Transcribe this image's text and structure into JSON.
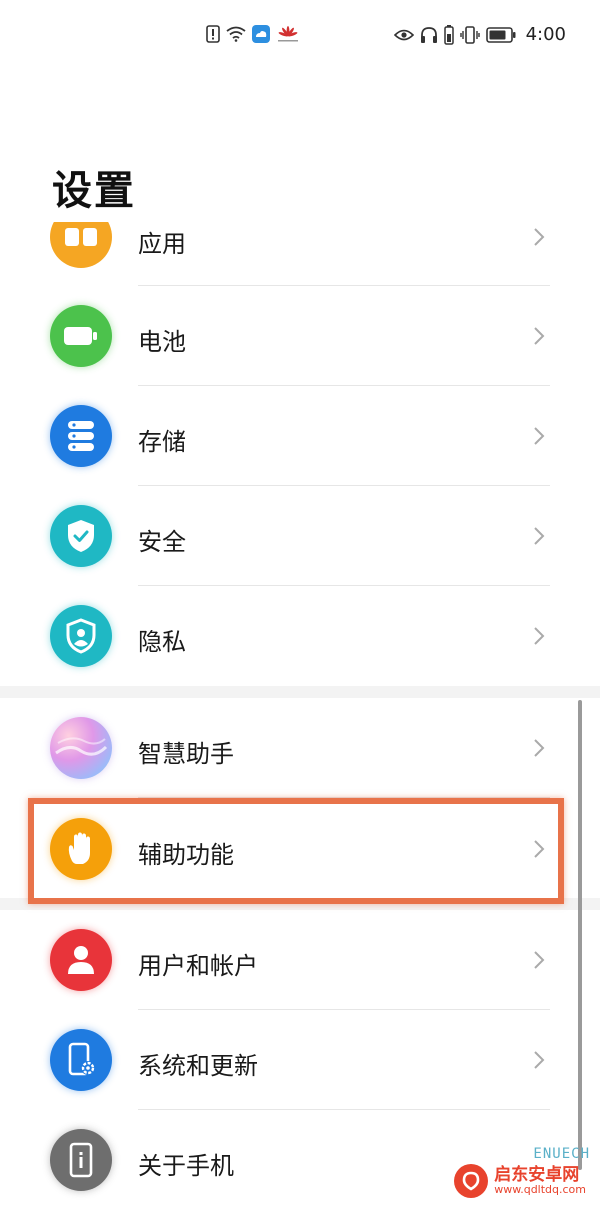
{
  "status_bar": {
    "time": "4:00",
    "left_icons": [
      "alert-sim-icon",
      "wifi-icon",
      "cloud-app-icon",
      "huawei-icon"
    ],
    "right_icons": [
      "eye-icon",
      "headphones-icon",
      "battery-saver-icon",
      "vibrate-icon",
      "battery-icon"
    ]
  },
  "page": {
    "title": "设置"
  },
  "items": [
    {
      "id": "apps",
      "label": "应用",
      "color": "#f5a623",
      "icon": "apps-icon"
    },
    {
      "id": "battery",
      "label": "电池",
      "color": "#4cc24c",
      "icon": "battery-icon"
    },
    {
      "id": "storage",
      "label": "存储",
      "color": "#1f7be0",
      "icon": "storage-icon"
    },
    {
      "id": "security",
      "label": "安全",
      "color": "#1fb8c4",
      "icon": "shield-check-icon"
    },
    {
      "id": "privacy",
      "label": "隐私",
      "color": "#1fb8c4",
      "icon": "privacy-shield-icon"
    },
    {
      "id": "assistant",
      "label": "智慧助手",
      "color": "#c490e8",
      "icon": "assistant-orb-icon"
    },
    {
      "id": "accessibility",
      "label": "辅助功能",
      "color": "#f5a00a",
      "icon": "hand-icon"
    },
    {
      "id": "accounts",
      "label": "用户和帐户",
      "color": "#e8343a",
      "icon": "user-icon"
    },
    {
      "id": "system",
      "label": "系统和更新",
      "color": "#1f7be0",
      "icon": "phone-gear-icon"
    },
    {
      "id": "about",
      "label": "关于手机",
      "color": "#6e6e6e",
      "icon": "phone-info-icon"
    }
  ],
  "highlight": {
    "target": "accessibility",
    "color": "#e8734a"
  },
  "watermark": {
    "brand": "启东安卓网",
    "url": "www.qdltdq.com",
    "top_text": "ENUECH"
  }
}
